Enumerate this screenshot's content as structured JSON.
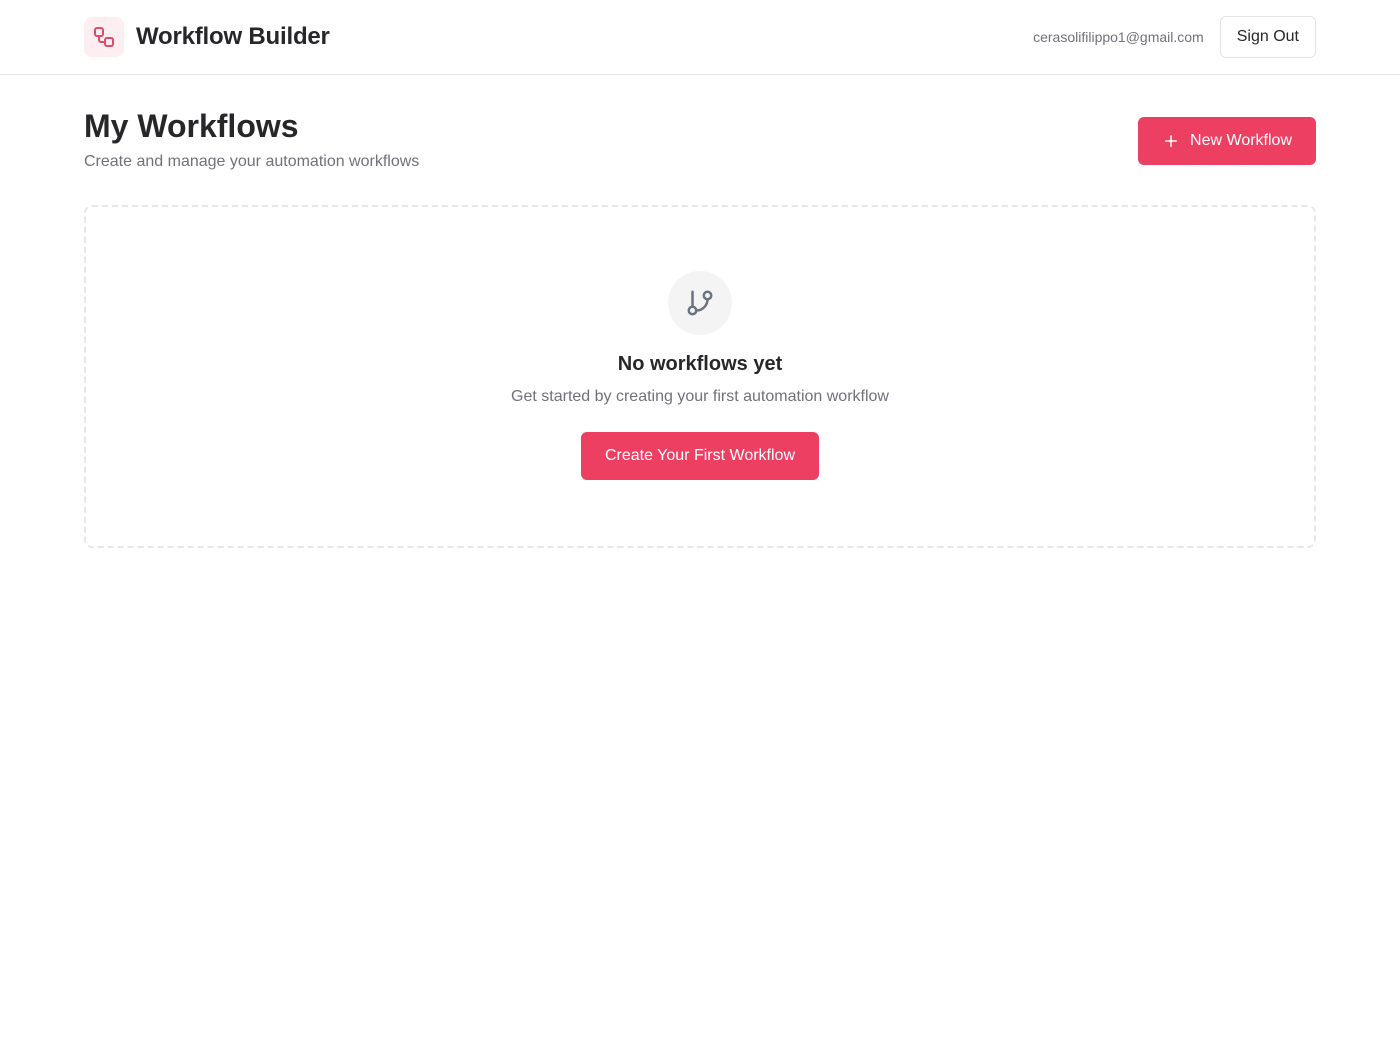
{
  "header": {
    "title": "Workflow Builder",
    "logo_icon": "workflow-icon",
    "user_email": "cerasolifilippo1@gmail.com",
    "signout_label": "Sign Out"
  },
  "page": {
    "title": "My Workflows",
    "subtitle": "Create and manage your automation workflows",
    "new_workflow_label": "New Workflow",
    "new_workflow_icon": "plus-icon"
  },
  "empty_state": {
    "icon": "git-branch-icon",
    "title": "No workflows yet",
    "description": "Get started by creating your first automation workflow",
    "cta_label": "Create Your First Workflow"
  },
  "colors": {
    "accent": "#ec3f62",
    "accent_light": "#fdeef1",
    "text_primary": "#27272a",
    "text_muted": "#71717a",
    "border": "#e5e7eb"
  }
}
